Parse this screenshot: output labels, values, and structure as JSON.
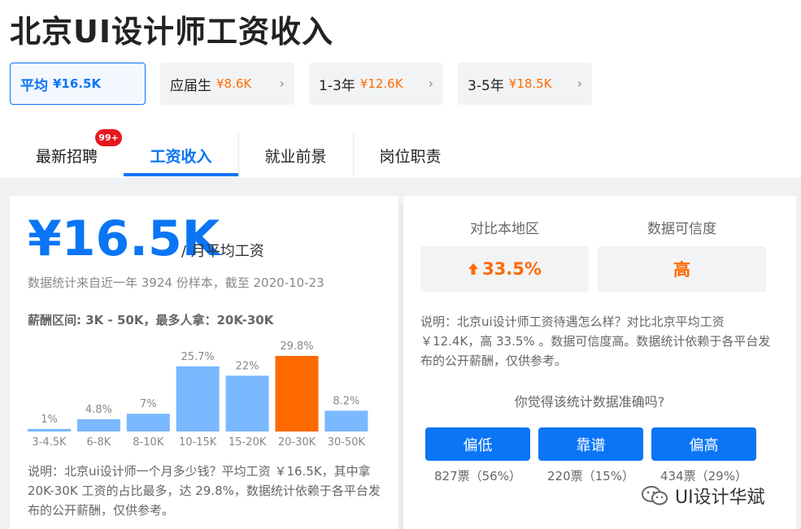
{
  "page": {
    "title": "北京UI设计师工资收入"
  },
  "filters": [
    {
      "label": "平均",
      "price": "¥16.5K",
      "active": true
    },
    {
      "label": "应届生",
      "price": "¥8.6K",
      "active": false
    },
    {
      "label": "1-3年",
      "price": "¥12.6K",
      "active": false
    },
    {
      "label": "3-5年",
      "price": "¥18.5K",
      "active": false
    }
  ],
  "tabs": [
    {
      "label": "最新招聘",
      "badge": "99+"
    },
    {
      "label": "工资收入",
      "active": true
    },
    {
      "label": "就业前景"
    },
    {
      "label": "岗位职责"
    }
  ],
  "salary": {
    "amount": "¥16.5K",
    "suffix": "/ 月平均工资",
    "note": "数据统计来自近一年 3924 份样本，截至 2020-10-23",
    "range_text": "薪酬区间: 3K - 50K，最多人拿：20K-30K",
    "description": "说明：北京ui设计师一个月多少钱？平均工资 ￥16.5K，其中拿 20K-30K 工资的占比最多，达 29.8%，数据统计依赖于各平台发布的公开薪酬，仅供参考。"
  },
  "chart_data": {
    "type": "bar",
    "categories": [
      "3-4.5K",
      "6-8K",
      "8-10K",
      "10-15K",
      "15-20K",
      "20-30K",
      "30-50K"
    ],
    "values": [
      1,
      4.8,
      7,
      25.7,
      22,
      29.8,
      8.2
    ],
    "value_labels": [
      "1%",
      "4.8%",
      "7%",
      "25.7%",
      "22%",
      "29.8%",
      "8.2%"
    ],
    "highlight_index": 5,
    "colors": {
      "bar": "#7ab8ff",
      "highlight": "#ff6a00"
    }
  },
  "comparison": {
    "local_label": "对比本地区",
    "local_value": "33.5%",
    "local_arrow": "up-arrow-icon",
    "confidence_label": "数据可信度",
    "confidence_value": "高",
    "description": "说明：北京ui设计师工资待遇怎么样？对比北京平均工资 ￥12.4K，高 33.5% 。数据可信度高。数据统计依赖于各平台发布的公开薪酬，仅供参考。"
  },
  "poll": {
    "question": "你觉得该统计数据准确吗?",
    "options": [
      {
        "label": "偏低",
        "count": "827票（56%）"
      },
      {
        "label": "靠谱",
        "count": "220票（15%）"
      },
      {
        "label": "偏高",
        "count": "434票（29%）"
      }
    ]
  },
  "watermark": {
    "text": "UI设计华斌",
    "icon": "wechat-icon"
  },
  "colors": {
    "accent": "#0a75f5",
    "orange": "#ff6a00",
    "badge": "#e8171d"
  }
}
